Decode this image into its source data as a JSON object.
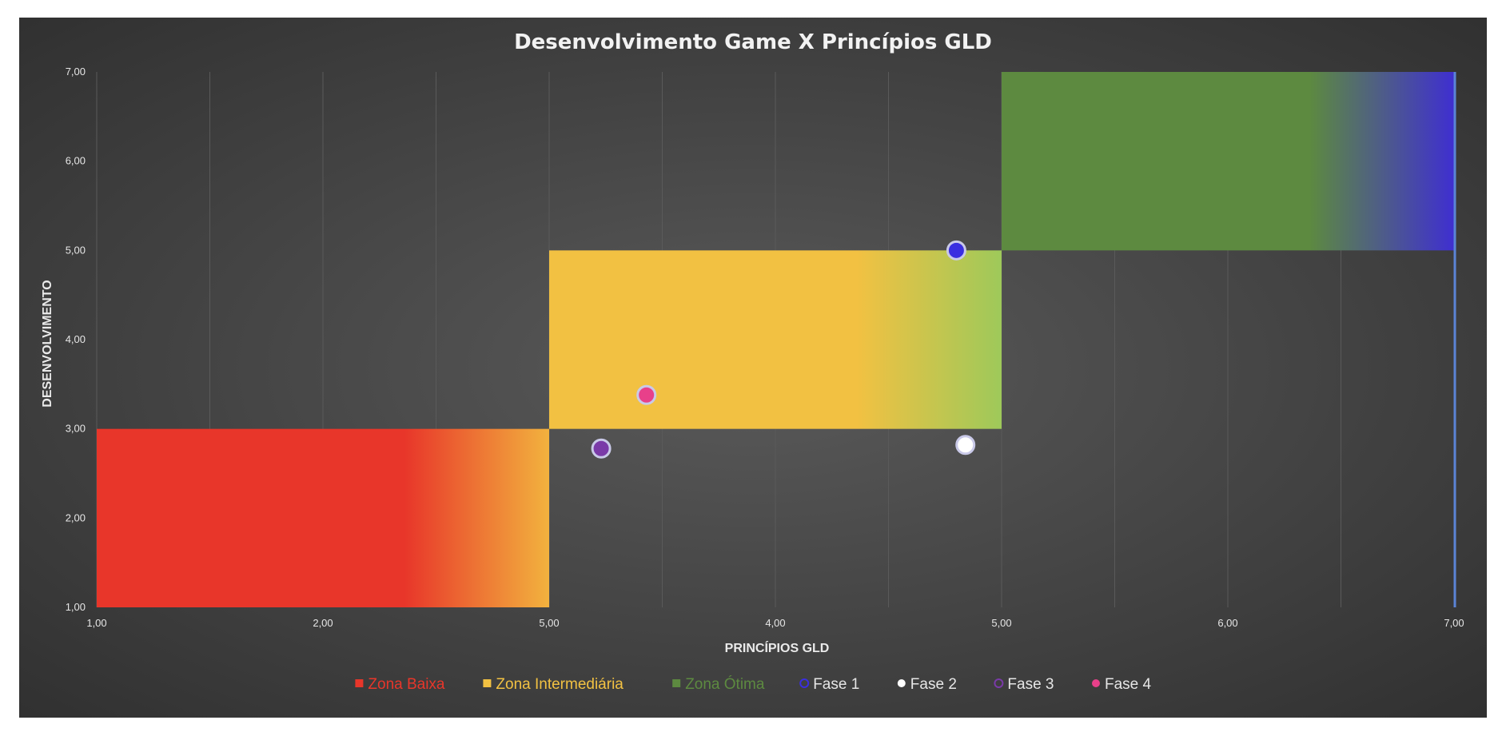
{
  "chart_data": {
    "type": "scatter",
    "title": "Desenvolvimento Game X Princípios GLD",
    "xlabel": "PRINCÍPIOS GLD",
    "ylabel": "DESENVOLVIMENTO",
    "xlim": [
      1,
      7
    ],
    "ylim": [
      1,
      7
    ],
    "x_ticks": [
      "1,00",
      "2,00",
      "5,00",
      "4,00",
      "5,00",
      "6,00",
      "7,00"
    ],
    "y_ticks": [
      "1,00",
      "2,00",
      "3,00",
      "4,00",
      "5,00",
      "6,00",
      "7,00"
    ],
    "grid": true,
    "legend_position": "bottom",
    "zones": [
      {
        "name": "Zona Baixa",
        "x": [
          1,
          3
        ],
        "y": [
          1,
          3
        ],
        "color": "#e8362a",
        "fade_to": "#f2b23e",
        "legend_color": "#e8362a"
      },
      {
        "name": "Zona Intermediária",
        "x": [
          3,
          5
        ],
        "y": [
          3,
          5
        ],
        "color": "#f2c142",
        "fade_to": "#9ec95a",
        "legend_color": "#f2c142"
      },
      {
        "name": "Zona Ótima",
        "x": [
          5,
          7
        ],
        "y": [
          5,
          7
        ],
        "color": "#5d8a40",
        "fade_to": "#3f2fd0",
        "legend_color": "#5d8a40"
      }
    ],
    "series": [
      {
        "name": "Fase 1",
        "points": [
          [
            4.8,
            5.0
          ]
        ],
        "color": "#3a2ee0"
      },
      {
        "name": "Fase 2",
        "points": [
          [
            4.84,
            2.82
          ]
        ],
        "color": "#ffffff"
      },
      {
        "name": "Fase 3",
        "points": [
          [
            3.23,
            2.78
          ]
        ],
        "color": "#7a3aa8"
      },
      {
        "name": "Fase 4",
        "points": [
          [
            3.43,
            3.38
          ]
        ],
        "color": "#e8408a"
      }
    ],
    "colors": {
      "background": "#3a3a3a",
      "grid": "#5a5a5a",
      "edge_line": "#5b84d6"
    }
  }
}
